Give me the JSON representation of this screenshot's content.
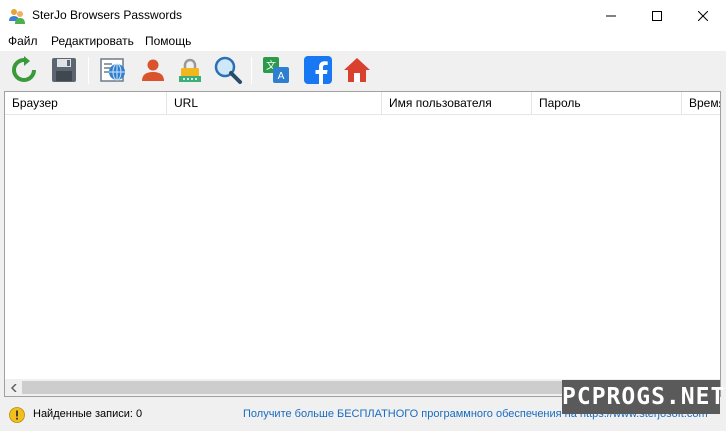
{
  "window": {
    "title": "SterJo Browsers Passwords",
    "app_icon": "people-icon",
    "controls": [
      "minimize-icon",
      "maximize-icon",
      "close-icon"
    ]
  },
  "menu": {
    "items": [
      {
        "label": "Файл"
      },
      {
        "label": "Редактировать"
      },
      {
        "label": "Помощь"
      }
    ]
  },
  "toolbar": {
    "buttons": [
      {
        "icon": "refresh-icon"
      },
      {
        "icon": "save-icon"
      },
      {
        "icon": "browser-list-icon"
      },
      {
        "icon": "user-icon"
      },
      {
        "icon": "lock-password-icon"
      },
      {
        "icon": "search-icon"
      },
      {
        "icon": "translate-icon"
      },
      {
        "icon": "facebook-icon"
      },
      {
        "icon": "home-icon"
      }
    ]
  },
  "table": {
    "columns": [
      {
        "label": "Браузер"
      },
      {
        "label": "URL"
      },
      {
        "label": "Имя пользователя"
      },
      {
        "label": "Пароль"
      },
      {
        "label": "Время"
      }
    ],
    "rows": []
  },
  "status": {
    "icon": "info-icon",
    "text": "Найденные записи: 0",
    "link": "Получите больше БЕСПЛАТНОГО программного обеспечения на https://www.sterjosoft.com"
  },
  "watermark": {
    "text": "PCPROGS.NET"
  },
  "colors": {
    "link": "#1a6bbf",
    "facebook": "#1877f2",
    "refresh": "#3a9a3a",
    "home": "#d9412e"
  }
}
